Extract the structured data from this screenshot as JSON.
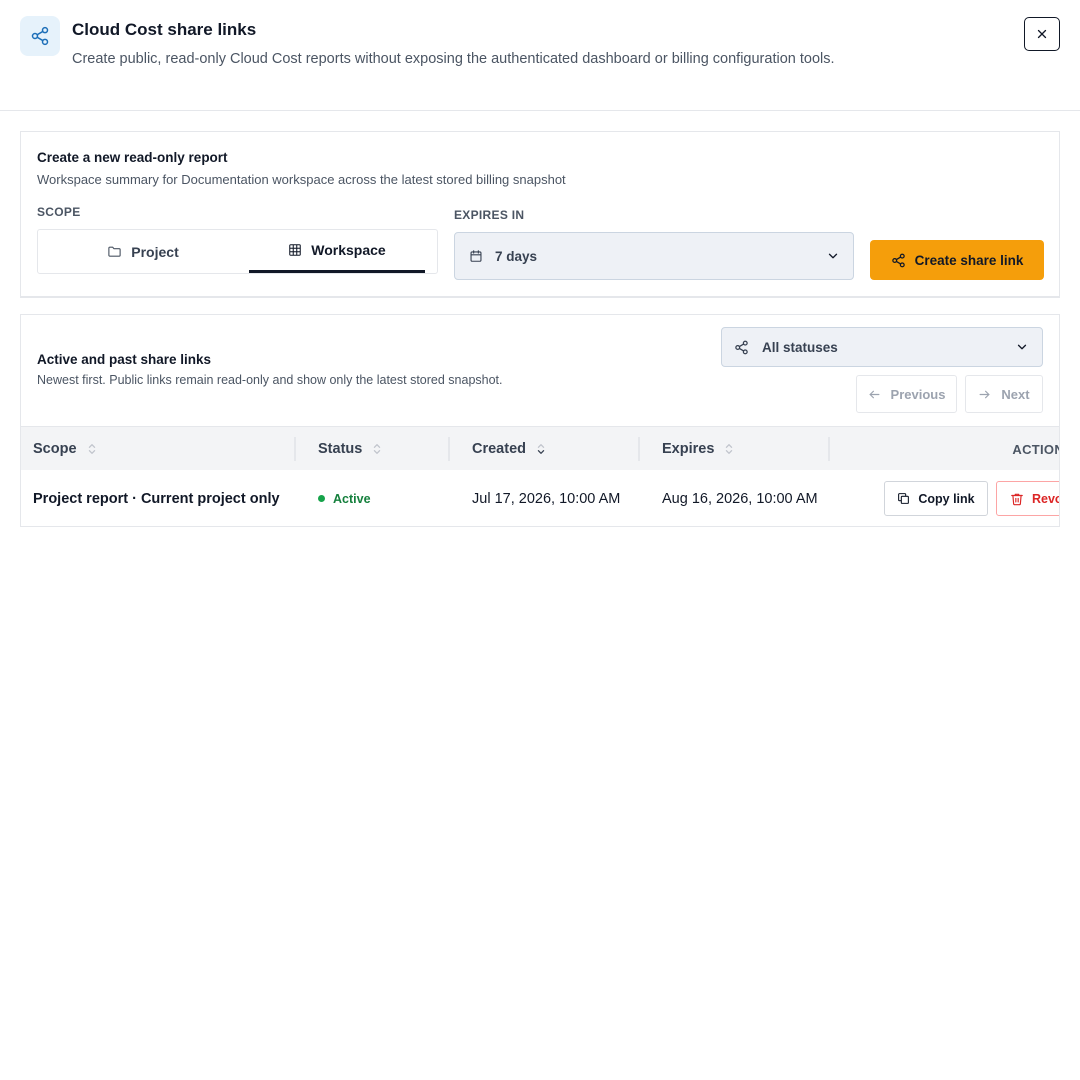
{
  "header": {
    "title": "Cloud Cost share links",
    "description": "Create public, read-only Cloud Cost reports without exposing the authenticated dashboard or billing configuration tools.",
    "icon": "share-icon",
    "close_icon": "close-icon"
  },
  "create": {
    "title": "Create a new read-only report",
    "subtitle": "Workspace summary for Documentation workspace across the latest stored billing snapshot",
    "scope_label": "SCOPE",
    "scope_options": [
      {
        "label": "Project",
        "icon": "folder-icon",
        "selected": false
      },
      {
        "label": "Workspace",
        "icon": "table-icon",
        "selected": true
      }
    ],
    "expires_label": "EXPIRES IN",
    "expires_value": "7 days",
    "create_button": "Create share link"
  },
  "links": {
    "title": "Active and past share links",
    "subtitle": "Newest first. Public links remain read-only and show only the latest stored snapshot.",
    "status_filter": "All statuses",
    "previous_label": "Previous",
    "next_label": "Next",
    "columns": {
      "scope": "Scope",
      "status": "Status",
      "created": "Created",
      "expires": "Expires",
      "actions": "ACTIONS"
    },
    "rows": [
      {
        "scope": "Project report · Current project only",
        "status": "Active",
        "created": "Jul 17, 2026, 10:00 AM",
        "expires": "Aug 16, 2026, 10:00 AM",
        "copy_label": "Copy link",
        "revoke_label": "Revoke"
      }
    ]
  },
  "colors": {
    "accent": "#f59e0b",
    "active": "#16a34a",
    "danger": "#dc2626"
  }
}
